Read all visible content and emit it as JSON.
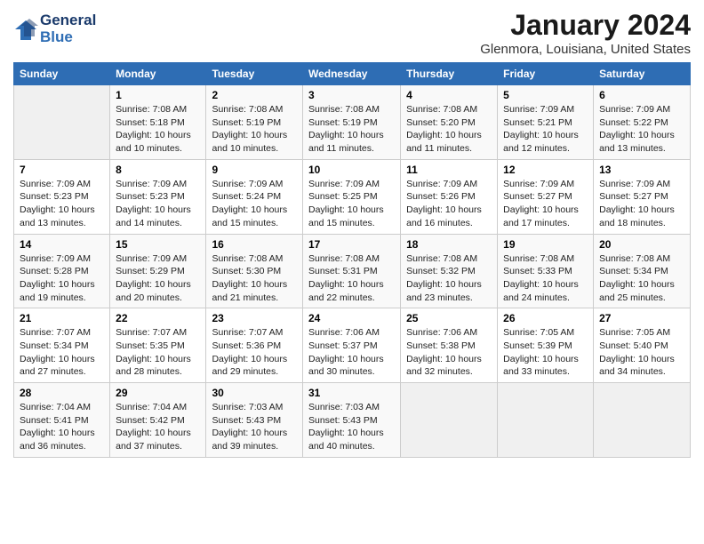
{
  "logo": {
    "line1": "General",
    "line2": "Blue"
  },
  "title": "January 2024",
  "subtitle": "Glenmora, Louisiana, United States",
  "headers": [
    "Sunday",
    "Monday",
    "Tuesday",
    "Wednesday",
    "Thursday",
    "Friday",
    "Saturday"
  ],
  "weeks": [
    [
      {
        "num": "",
        "sunrise": "",
        "sunset": "",
        "daylight": ""
      },
      {
        "num": "1",
        "sunrise": "7:08 AM",
        "sunset": "5:18 PM",
        "daylight": "10 hours and 10 minutes."
      },
      {
        "num": "2",
        "sunrise": "7:08 AM",
        "sunset": "5:19 PM",
        "daylight": "10 hours and 10 minutes."
      },
      {
        "num": "3",
        "sunrise": "7:08 AM",
        "sunset": "5:19 PM",
        "daylight": "10 hours and 11 minutes."
      },
      {
        "num": "4",
        "sunrise": "7:08 AM",
        "sunset": "5:20 PM",
        "daylight": "10 hours and 11 minutes."
      },
      {
        "num": "5",
        "sunrise": "7:09 AM",
        "sunset": "5:21 PM",
        "daylight": "10 hours and 12 minutes."
      },
      {
        "num": "6",
        "sunrise": "7:09 AM",
        "sunset": "5:22 PM",
        "daylight": "10 hours and 13 minutes."
      }
    ],
    [
      {
        "num": "7",
        "sunrise": "7:09 AM",
        "sunset": "5:23 PM",
        "daylight": "10 hours and 13 minutes."
      },
      {
        "num": "8",
        "sunrise": "7:09 AM",
        "sunset": "5:23 PM",
        "daylight": "10 hours and 14 minutes."
      },
      {
        "num": "9",
        "sunrise": "7:09 AM",
        "sunset": "5:24 PM",
        "daylight": "10 hours and 15 minutes."
      },
      {
        "num": "10",
        "sunrise": "7:09 AM",
        "sunset": "5:25 PM",
        "daylight": "10 hours and 15 minutes."
      },
      {
        "num": "11",
        "sunrise": "7:09 AM",
        "sunset": "5:26 PM",
        "daylight": "10 hours and 16 minutes."
      },
      {
        "num": "12",
        "sunrise": "7:09 AM",
        "sunset": "5:27 PM",
        "daylight": "10 hours and 17 minutes."
      },
      {
        "num": "13",
        "sunrise": "7:09 AM",
        "sunset": "5:27 PM",
        "daylight": "10 hours and 18 minutes."
      }
    ],
    [
      {
        "num": "14",
        "sunrise": "7:09 AM",
        "sunset": "5:28 PM",
        "daylight": "10 hours and 19 minutes."
      },
      {
        "num": "15",
        "sunrise": "7:09 AM",
        "sunset": "5:29 PM",
        "daylight": "10 hours and 20 minutes."
      },
      {
        "num": "16",
        "sunrise": "7:08 AM",
        "sunset": "5:30 PM",
        "daylight": "10 hours and 21 minutes."
      },
      {
        "num": "17",
        "sunrise": "7:08 AM",
        "sunset": "5:31 PM",
        "daylight": "10 hours and 22 minutes."
      },
      {
        "num": "18",
        "sunrise": "7:08 AM",
        "sunset": "5:32 PM",
        "daylight": "10 hours and 23 minutes."
      },
      {
        "num": "19",
        "sunrise": "7:08 AM",
        "sunset": "5:33 PM",
        "daylight": "10 hours and 24 minutes."
      },
      {
        "num": "20",
        "sunrise": "7:08 AM",
        "sunset": "5:34 PM",
        "daylight": "10 hours and 25 minutes."
      }
    ],
    [
      {
        "num": "21",
        "sunrise": "7:07 AM",
        "sunset": "5:34 PM",
        "daylight": "10 hours and 27 minutes."
      },
      {
        "num": "22",
        "sunrise": "7:07 AM",
        "sunset": "5:35 PM",
        "daylight": "10 hours and 28 minutes."
      },
      {
        "num": "23",
        "sunrise": "7:07 AM",
        "sunset": "5:36 PM",
        "daylight": "10 hours and 29 minutes."
      },
      {
        "num": "24",
        "sunrise": "7:06 AM",
        "sunset": "5:37 PM",
        "daylight": "10 hours and 30 minutes."
      },
      {
        "num": "25",
        "sunrise": "7:06 AM",
        "sunset": "5:38 PM",
        "daylight": "10 hours and 32 minutes."
      },
      {
        "num": "26",
        "sunrise": "7:05 AM",
        "sunset": "5:39 PM",
        "daylight": "10 hours and 33 minutes."
      },
      {
        "num": "27",
        "sunrise": "7:05 AM",
        "sunset": "5:40 PM",
        "daylight": "10 hours and 34 minutes."
      }
    ],
    [
      {
        "num": "28",
        "sunrise": "7:04 AM",
        "sunset": "5:41 PM",
        "daylight": "10 hours and 36 minutes."
      },
      {
        "num": "29",
        "sunrise": "7:04 AM",
        "sunset": "5:42 PM",
        "daylight": "10 hours and 37 minutes."
      },
      {
        "num": "30",
        "sunrise": "7:03 AM",
        "sunset": "5:43 PM",
        "daylight": "10 hours and 39 minutes."
      },
      {
        "num": "31",
        "sunrise": "7:03 AM",
        "sunset": "5:43 PM",
        "daylight": "10 hours and 40 minutes."
      },
      {
        "num": "",
        "sunrise": "",
        "sunset": "",
        "daylight": ""
      },
      {
        "num": "",
        "sunrise": "",
        "sunset": "",
        "daylight": ""
      },
      {
        "num": "",
        "sunrise": "",
        "sunset": "",
        "daylight": ""
      }
    ]
  ],
  "labels": {
    "sunrise": "Sunrise:",
    "sunset": "Sunset:",
    "daylight": "Daylight: 10 hours"
  }
}
